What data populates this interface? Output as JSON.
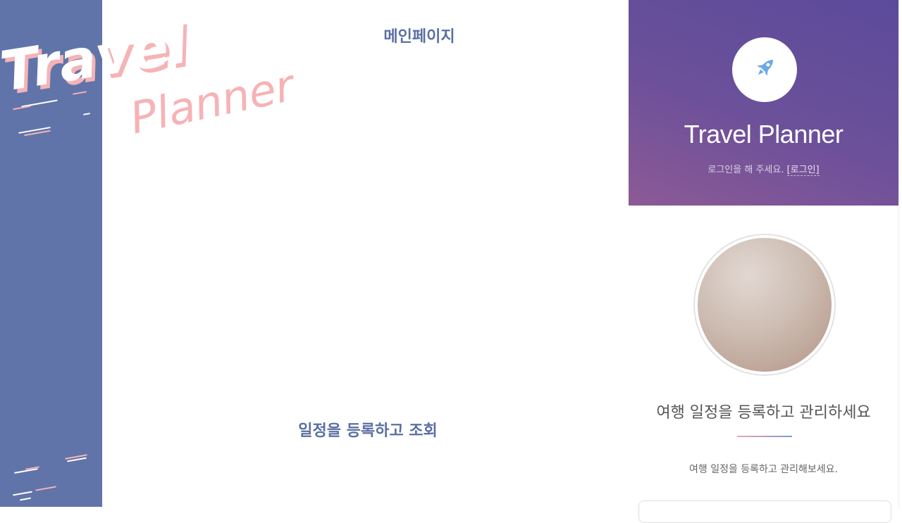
{
  "logo": {
    "word1": "Travel",
    "word2": "Planner"
  },
  "main": {
    "title": "메인페이지",
    "section_title": "일정을 등록하고 조회"
  },
  "panel": {
    "hero_title": "Travel Planner",
    "login_prompt": "로그인을 해 주세요.",
    "login_link": "[로그인]",
    "icon": "rocket-icon",
    "heading": "여행 일정을 등록하고 관리하세요",
    "description": "여행 일정을 등록하고 관리해보세요."
  },
  "colors": {
    "left_band": "#6074a9",
    "logo_pink": "#f6b3b6",
    "heading_blue": "#5a6fa4",
    "hero_purple": "#5b4b9b",
    "rocket_blue": "#6aa9e6"
  }
}
